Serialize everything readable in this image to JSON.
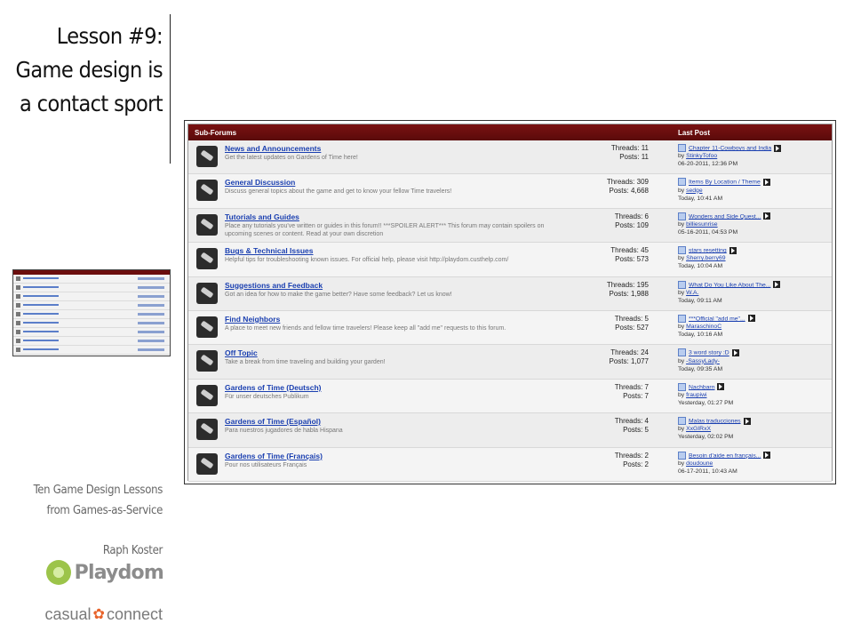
{
  "slide": {
    "title_lines": [
      "Lesson #9:",
      "Game design is",
      "a contact sport"
    ],
    "credit_line1": "Ten Game Design Lessons",
    "credit_line2": "from Games-as-Service",
    "author": "Raph Koster",
    "playdom_logo_text": "Playdom",
    "casual_connect_text_left": "casual",
    "casual_connect_text_right": "connect"
  },
  "forum": {
    "header_left": "Sub-Forums",
    "header_right": "Last Post",
    "threads_label": "Threads:",
    "posts_label": "Posts:",
    "by_label": "by",
    "rows": [
      {
        "name": "News and Announcements",
        "desc": "Get the latest updates on Gardens of Time here!",
        "threads": "11",
        "posts": "11",
        "lp_title": "Chapter 11-Cowboys and India",
        "lp_user": "StinkyTofoo",
        "lp_time": "06-20-2011, 12:36 PM"
      },
      {
        "name": "General Discussion",
        "desc": "Discuss general topics about the game and get to know your fellow Time travelers!",
        "threads": "309",
        "posts": "4,668",
        "lp_title": "Items By Location / Theme",
        "lp_user": "sedge",
        "lp_time": "Today, 10:41 AM"
      },
      {
        "name": "Tutorials and Guides",
        "desc": "Place any tutorials you've written or guides in this forum!! ***SPOILER ALERT*** This forum may contain spoilers on upcoming scenes or content. Read at your own discretion",
        "threads": "6",
        "posts": "109",
        "lp_title": "Wonders and Side Quest...",
        "lp_user": "billiesunrise",
        "lp_time": "05-16-2011, 04:53 PM"
      },
      {
        "name": "Bugs & Technical Issues",
        "desc": "Helpful tips for troubleshooting known issues. For official help, please visit http://playdom.custhelp.com/",
        "threads": "45",
        "posts": "573",
        "lp_title": "stars resetting",
        "lp_user": "Sherry.berry69",
        "lp_time": "Today, 10:04 AM"
      },
      {
        "name": "Suggestions and Feedback",
        "desc": "Got an idea for how to make the game better? Have some feedback? Let us know!",
        "threads": "195",
        "posts": "1,988",
        "lp_title": "What Do You Like About The...",
        "lp_user": "W.A.",
        "lp_time": "Today, 09:11 AM"
      },
      {
        "name": "Find Neighbors",
        "desc": "A place to meet new friends and fellow time travelers! Please keep all \"add me\" requests to this forum.",
        "threads": "5",
        "posts": "527",
        "lp_title": "***Official \"add me\"...",
        "lp_user": "MaraschinoC",
        "lp_time": "Today, 10:16 AM"
      },
      {
        "name": "Off Topic",
        "desc": "Take a break from time traveling and building your garden!",
        "threads": "24",
        "posts": "1,077",
        "lp_title": "3 word story :D",
        "lp_user": "-SassyLady-",
        "lp_time": "Today, 09:35 AM"
      },
      {
        "name": "Gardens of Time (Deutsch)",
        "desc": "Für unser deutsches Publikum",
        "threads": "7",
        "posts": "7",
        "lp_title": "Nachbarn",
        "lp_user": "fraupiwi",
        "lp_time": "Yesterday, 01:27 PM"
      },
      {
        "name": "Gardens of Time (Español)",
        "desc": "Para nuestros jugadores de habla Hispana",
        "threads": "4",
        "posts": "5",
        "lp_title": "Malas traducciones",
        "lp_user": "XxGIRxX",
        "lp_time": "Yesterday, 02:02 PM"
      },
      {
        "name": "Gardens of Time (Français)",
        "desc": "Pour nos utilisateurs Français",
        "threads": "2",
        "posts": "2",
        "lp_title": "Besoin d'aide en français...",
        "lp_user": "doudoune",
        "lp_time": "06-17-2011, 10:43 AM"
      }
    ]
  }
}
